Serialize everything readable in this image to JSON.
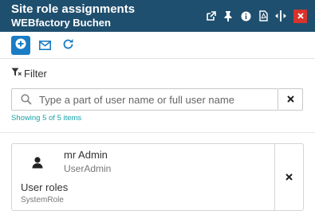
{
  "window": {
    "title": "Site role assignments",
    "subtitle": "WEBfactory Buchen",
    "header_color": "#1f4f6e",
    "close_color": "#d9332b",
    "icons": [
      "popout-icon",
      "pin-icon",
      "info-icon",
      "pdf-icon",
      "resize-icon",
      "close-icon"
    ]
  },
  "toolbar": {
    "accent_color": "#1a7cc4",
    "icons": [
      "add-icon",
      "mail-icon",
      "refresh-icon"
    ]
  },
  "filter": {
    "label": "Filter",
    "search_placeholder": "Type a part of user name or full user name",
    "search_value": "",
    "status": "Showing 5 of 5 items"
  },
  "assignments": [
    {
      "user_name": "mr Admin",
      "user_login": "UserAdmin",
      "roles_label": "User roles",
      "role": "SystemRole"
    }
  ]
}
